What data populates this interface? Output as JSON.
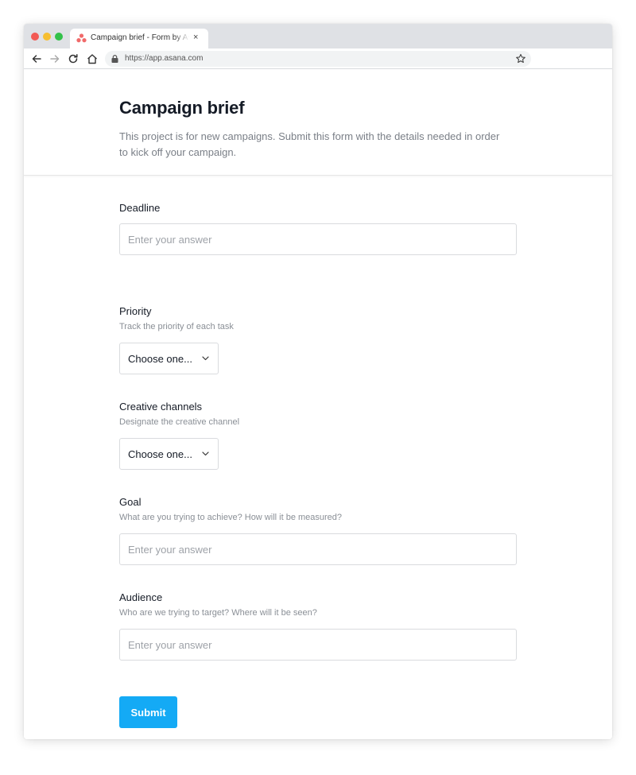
{
  "browser": {
    "tab_title": "Campaign brief - Form by Asana",
    "tab_close": "×",
    "url": "https://app.asana.com",
    "icons": {
      "back": "arrow-left",
      "forward": "arrow-right",
      "reload": "reload",
      "home": "home",
      "lock": "lock",
      "bookmark": "star",
      "favicon": "asana-logo"
    },
    "favicon_color": "#f06a6a"
  },
  "form": {
    "title": "Campaign brief",
    "description": "This project is for new campaigns. Submit this form with the details needed in order to kick off your campaign.",
    "fields": [
      {
        "label": "Deadline",
        "help": "",
        "type": "text",
        "placeholder": "Enter your answer",
        "value": ""
      },
      {
        "label": "Priority",
        "help": "Track the priority of each task",
        "type": "select",
        "selected": "Choose one..."
      },
      {
        "label": "Creative channels",
        "help": "Designate the creative channel",
        "type": "select",
        "selected": "Choose one..."
      },
      {
        "label": "Goal",
        "help": "What are you trying to achieve? How will it be measured?",
        "type": "text",
        "placeholder": "Enter your answer",
        "value": ""
      },
      {
        "label": "Audience",
        "help": "Who are we trying to target? Where will it be seen?",
        "type": "text",
        "placeholder": "Enter your answer",
        "value": ""
      }
    ],
    "submit_label": "Submit",
    "accent_color": "#14aaf5"
  }
}
